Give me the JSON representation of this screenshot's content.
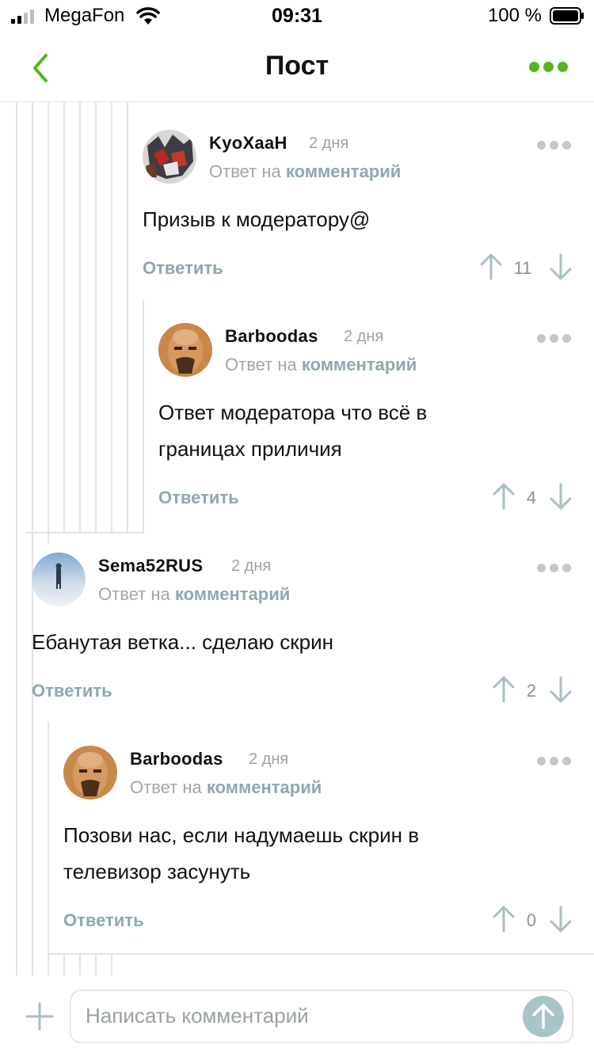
{
  "status_bar": {
    "carrier": "MegaFon",
    "time": "09:31",
    "battery": "100 %"
  },
  "nav": {
    "title": "Пост"
  },
  "comments": [
    {
      "author": "KyoXaaH",
      "date": "2 дня",
      "reply_prefix": "Ответ на",
      "reply_link": "комментарий",
      "text": "Призыв к модератору@",
      "reply_label": "Ответить",
      "score": "11"
    },
    {
      "author": "Barboodas",
      "date": "2 дня",
      "reply_prefix": "Ответ на",
      "reply_link": "комментарий",
      "text_line1": "Ответ модератора что всё в",
      "text_line2": "границах приличия",
      "reply_label": "Ответить",
      "score": "4"
    },
    {
      "author": "Sema52RUS",
      "date": "2 дня",
      "reply_prefix": "Ответ на",
      "reply_link": "комментарий",
      "text": "Ебанутая ветка... сделаю скрин",
      "reply_label": "Ответить",
      "score": "2"
    },
    {
      "author": "Barboodas",
      "date": "2 дня",
      "reply_prefix": "Ответ на",
      "reply_link": "комментарий",
      "text_line1": "Позови нас, если надумаешь скрин в",
      "text_line2": "телевизор засунуть",
      "reply_label": "Ответить",
      "score": "0"
    }
  ],
  "composer": {
    "placeholder": "Написать комментарий"
  },
  "colors": {
    "accent_green": "#57b51c",
    "muted_teal": "#8ea9ad",
    "send_button": "#a9c4c6"
  }
}
